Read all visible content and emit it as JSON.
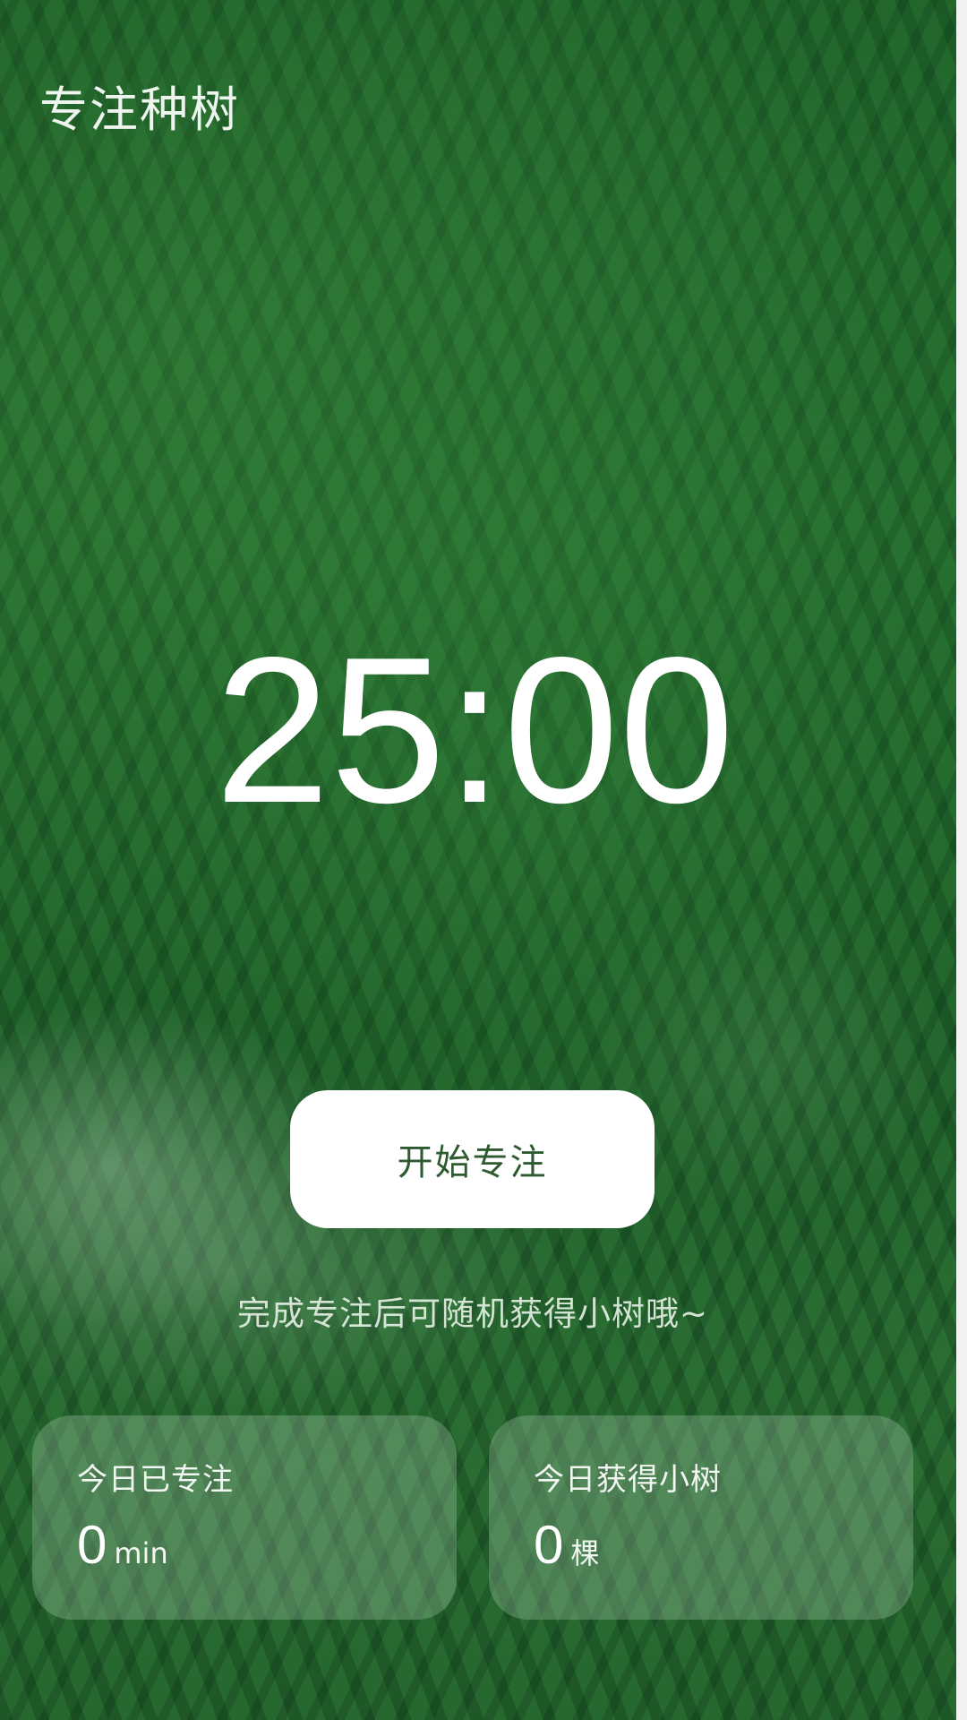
{
  "app": {
    "title": "专注种树"
  },
  "timer": {
    "display": "25:00"
  },
  "actions": {
    "start_label": "开始专注"
  },
  "hint": "完成专注后可随机获得小树哦~",
  "stats": [
    {
      "label": "今日已专注",
      "value": "0",
      "unit": "min"
    },
    {
      "label": "今日获得小树",
      "value": "0",
      "unit": "棵"
    }
  ],
  "colors": {
    "background": "#1f5f2a",
    "button_bg": "#ffffff",
    "button_text": "#2e5a30",
    "card_bg": "rgba(200,225,205,0.26)"
  }
}
